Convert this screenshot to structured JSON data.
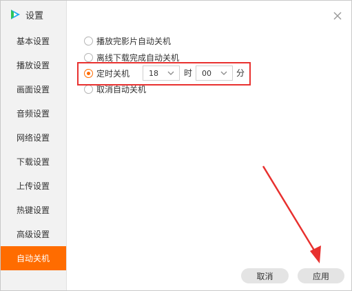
{
  "window": {
    "title": "设置"
  },
  "sidebar": {
    "items": [
      {
        "label": "基本设置"
      },
      {
        "label": "播放设置"
      },
      {
        "label": "画面设置"
      },
      {
        "label": "音频设置"
      },
      {
        "label": "网络设置"
      },
      {
        "label": "下载设置"
      },
      {
        "label": "上传设置"
      },
      {
        "label": "热键设置"
      },
      {
        "label": "高级设置"
      },
      {
        "label": "自动关机",
        "active": true
      }
    ]
  },
  "options": [
    {
      "label": "播放完影片自动关机",
      "checked": false
    },
    {
      "label": "离线下载完成自动关机",
      "checked": false
    },
    {
      "label": "定时关机",
      "checked": true
    },
    {
      "label": "取消自动关机",
      "checked": false
    }
  ],
  "timer": {
    "hour_value": "18",
    "hour_unit": "时",
    "minute_value": "00",
    "minute_unit": "分"
  },
  "buttons": {
    "cancel": "取消",
    "apply": "应用"
  },
  "colors": {
    "accent": "#ff6c00",
    "annotation": "#e8302e"
  }
}
